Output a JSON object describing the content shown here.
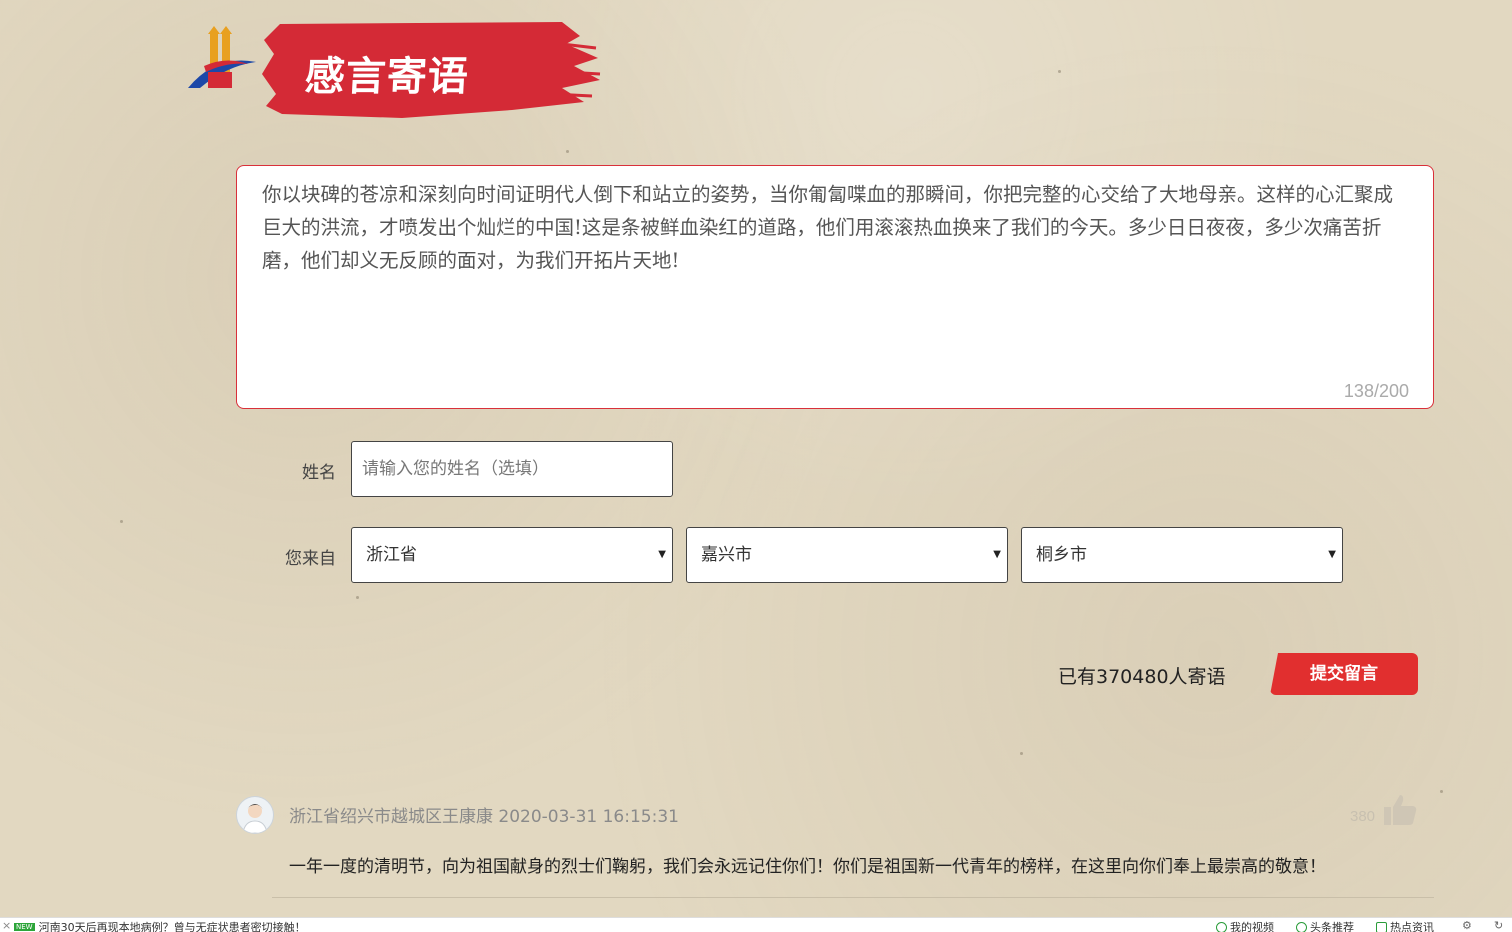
{
  "header": {
    "title": "感言寄语",
    "logo_icon": "party-logo-icon",
    "brand_color": "#d42a36"
  },
  "message": {
    "text": "你以块碑的苍凉和深刻向时间证明代人倒下和站立的姿势，当你匍匐喋血的那瞬间，你把完整的心交给了大地母亲。这样的心汇聚成巨大的洪流，才喷发出个灿烂的中国!这是条被鲜血染红的道路，他们用滚滚热血换来了我们的今天。多少日日夜夜，多少次痛苦折磨，他们却义无反顾的面对，为我们开拓片天地!",
    "char_count": "138/200"
  },
  "form": {
    "name_label": "姓名",
    "name_placeholder": "请输入您的姓名（选填）",
    "from_label": "您来自",
    "province": "浙江省",
    "city": "嘉兴市",
    "county": "桐乡市"
  },
  "submit": {
    "count_text": "已有370480人寄语",
    "button_label": "提交留言",
    "button_color": "#e12f2f"
  },
  "comment": {
    "meta": "浙江省绍兴市越城区王康康 2020-03-31 16:15:31",
    "likes": "380",
    "body": "一年一度的清明节，向为祖国献身的烈士们鞠躬，我们会永远记住你们！你们是祖国新一代青年的榜样，在这里向你们奉上最崇高的敬意！"
  },
  "bottom_bar": {
    "news_badge": "NEW",
    "news_text": "河南30天后再现本地病例？曾与无症状患者密切接触！",
    "links": [
      "我的视频",
      "头条推荐",
      "热点资讯"
    ]
  }
}
